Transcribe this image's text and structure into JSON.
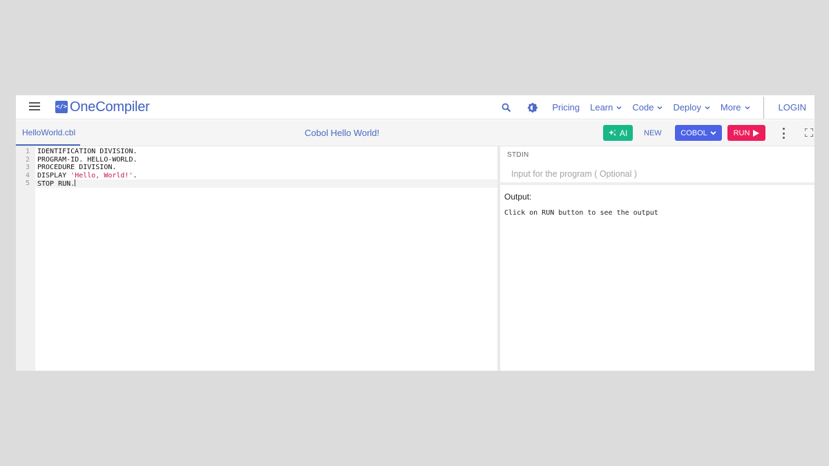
{
  "header": {
    "brand": "OneCompiler",
    "brand_icon": "</>",
    "nav": {
      "pricing": "Pricing",
      "learn": "Learn",
      "code": "Code",
      "deploy": "Deploy",
      "more": "More",
      "login": "LOGIN"
    },
    "icons": [
      "menu-icon",
      "search-icon",
      "theme-toggle-icon",
      "chevron-down-icon"
    ]
  },
  "toolbar": {
    "file_name": "HelloWorld.cbl",
    "title": "Cobol Hello World!",
    "ai_label": "AI",
    "new_label": "NEW",
    "language_label": "COBOL",
    "run_label": "RUN"
  },
  "editor": {
    "lines": [
      {
        "num": "1",
        "text": "IDENTIFICATION DIVISION."
      },
      {
        "num": "2",
        "text": "PROGRAM-ID. HELLO-WORLD."
      },
      {
        "num": "3",
        "text": "PROCEDURE DIVISION."
      },
      {
        "num": "4",
        "text_prefix": "DISPLAY ",
        "string": "'Hello, World!'",
        "text_suffix": "."
      },
      {
        "num": "5",
        "text": "STOP RUN."
      }
    ]
  },
  "stdin": {
    "label": "STDIN",
    "placeholder": "Input for the program ( Optional )"
  },
  "output": {
    "label": "Output:",
    "text": "Click on RUN button to see the output"
  },
  "colors": {
    "brand": "#4a67c4",
    "ai_button": "#18b886",
    "language_button": "#4c63e6",
    "run_button": "#ec1e5c",
    "string": "#c2185b"
  }
}
